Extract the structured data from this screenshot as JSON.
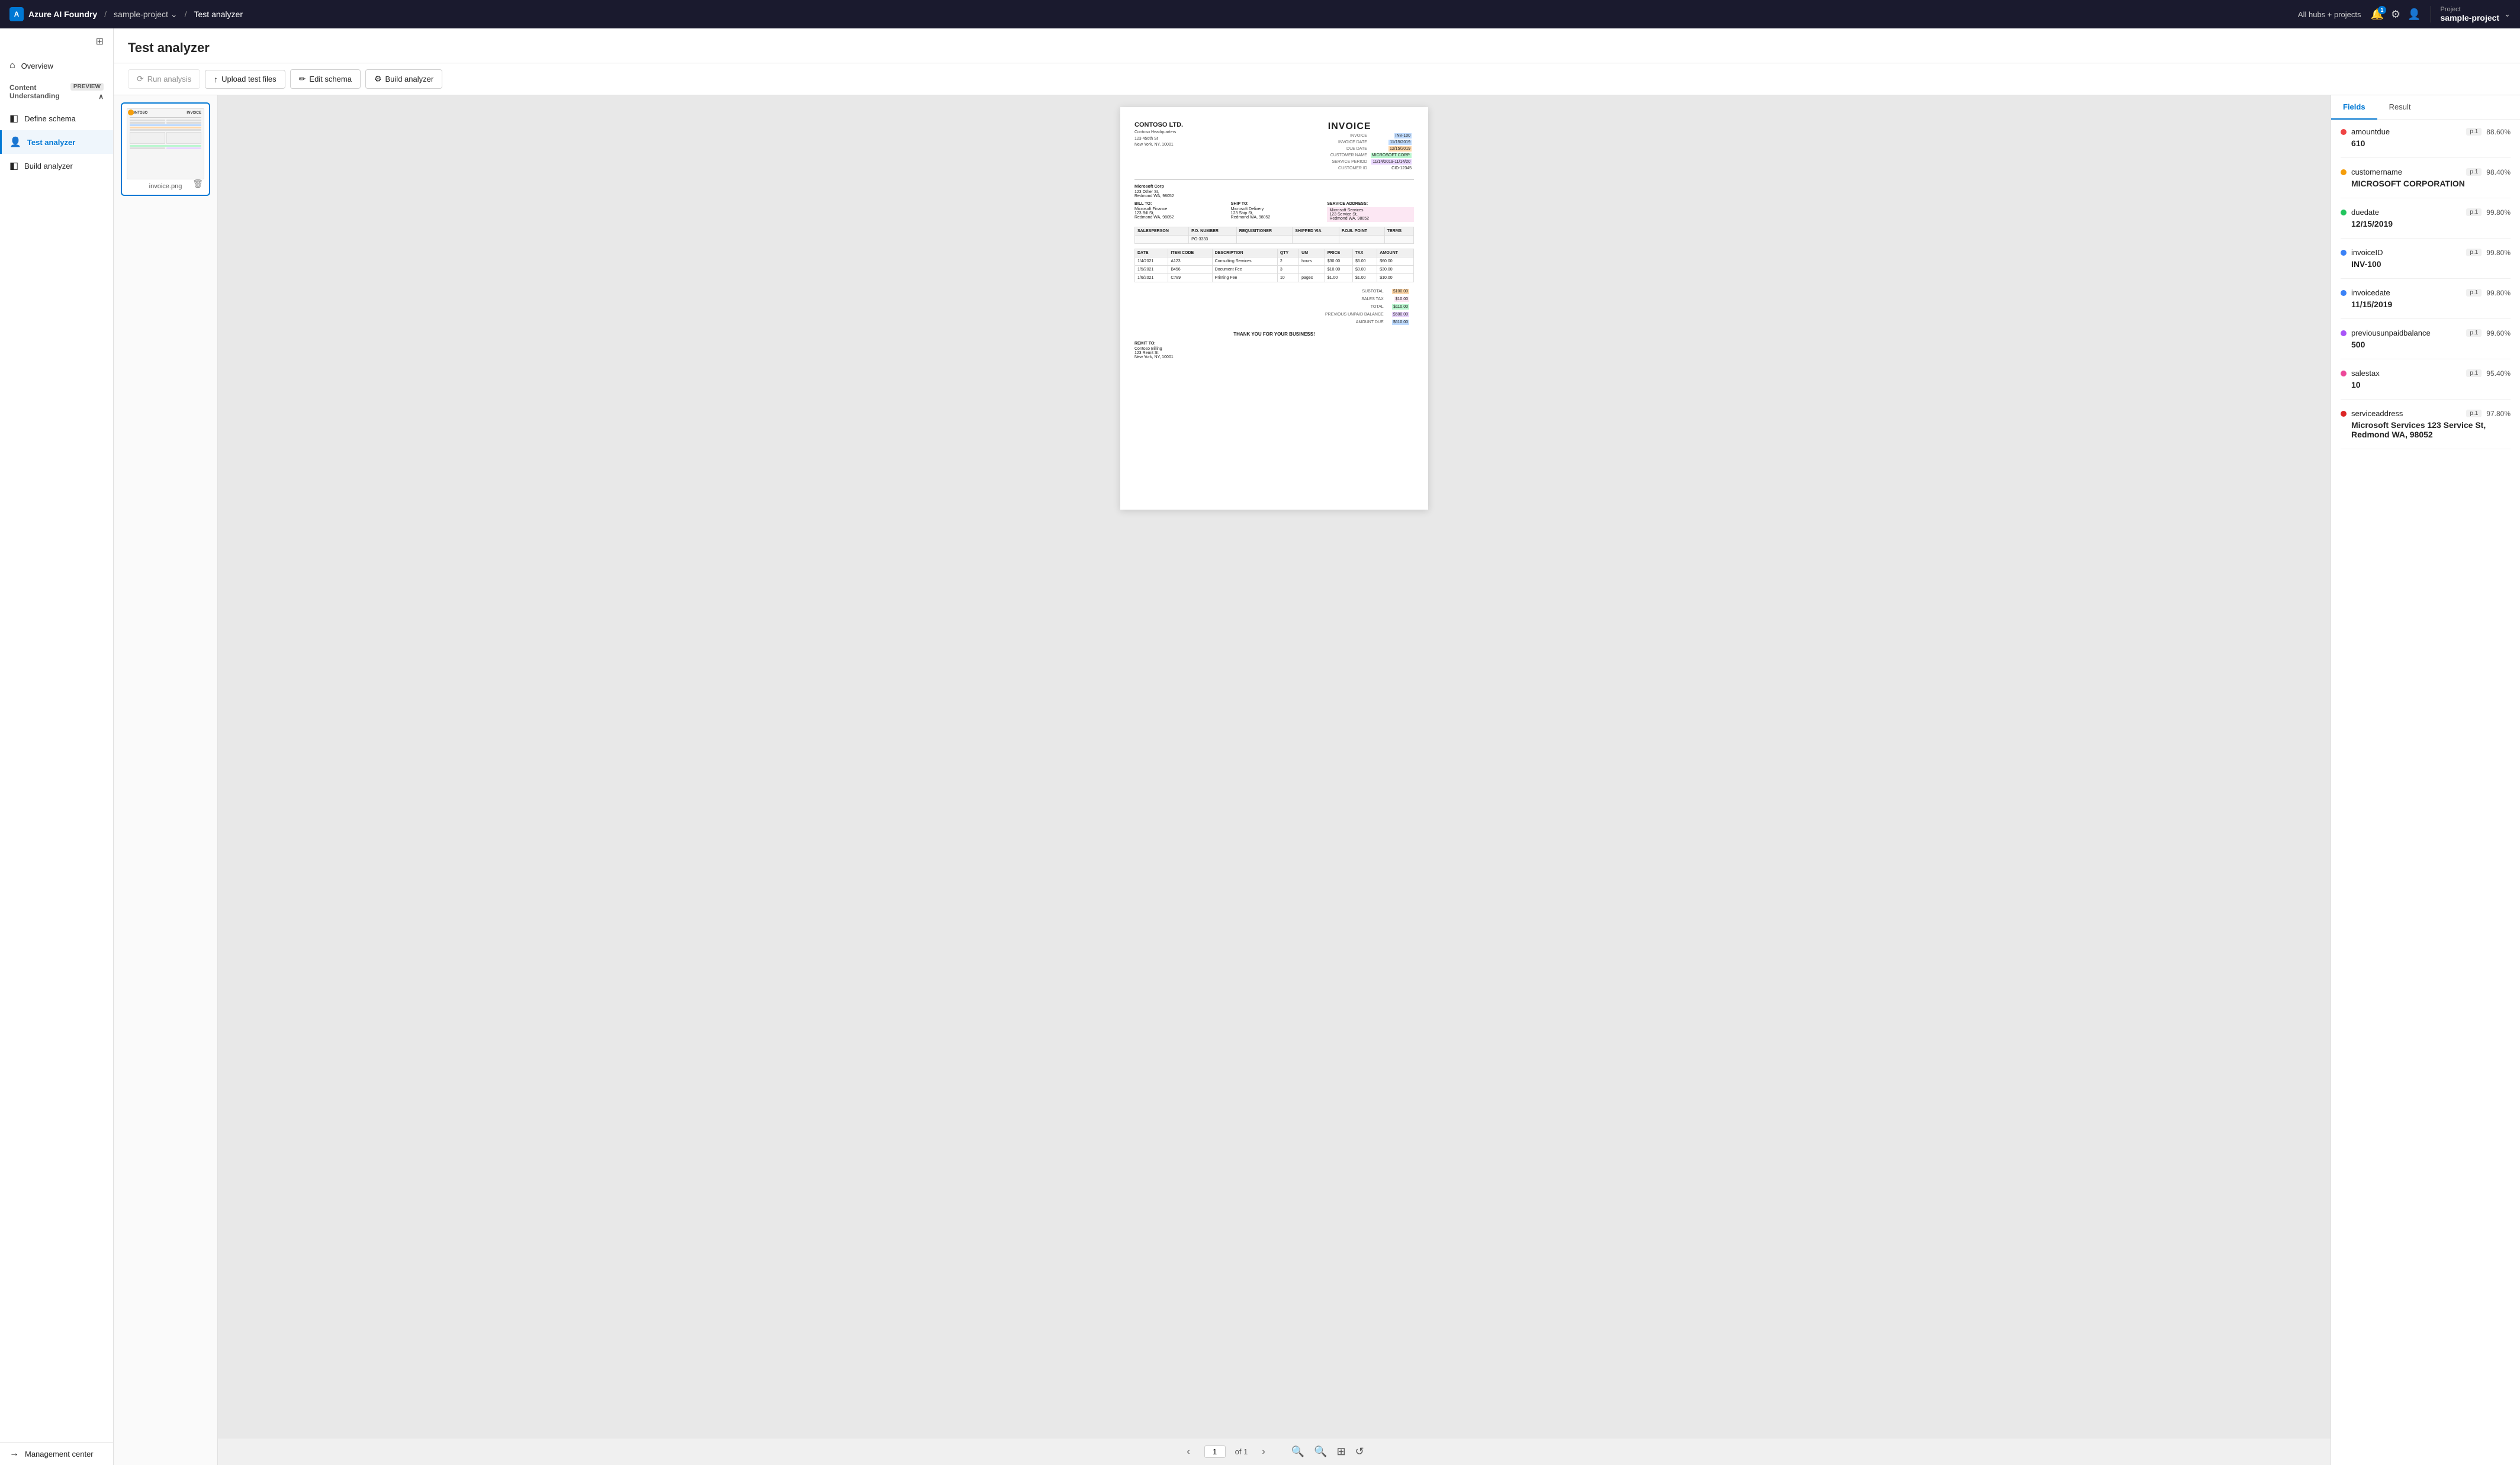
{
  "topnav": {
    "brand": "Azure AI Foundry",
    "breadcrumb": [
      {
        "label": "sample-project",
        "hasChevron": true
      },
      {
        "label": "Test analyzer"
      }
    ],
    "hub_projects": "All hubs + projects",
    "notification_count": "1",
    "project_label": "Project",
    "project_name": "sample-project"
  },
  "sidebar": {
    "toggle_icon": "⊞",
    "overview": "Overview",
    "group_label": "Content Understanding",
    "preview_badge": "PREVIEW",
    "items": [
      {
        "id": "define-schema",
        "label": "Define schema",
        "icon": "◧"
      },
      {
        "id": "test-analyzer",
        "label": "Test analyzer",
        "icon": "👤",
        "active": true
      },
      {
        "id": "build-analyzer",
        "label": "Build analyzer",
        "icon": "◧"
      }
    ],
    "management_center": "Management center"
  },
  "main": {
    "title": "Test analyzer",
    "toolbar": {
      "run_analysis": "Run analysis",
      "upload_test_files": "Upload test files",
      "edit_schema": "Edit schema",
      "build_analyzer": "Build analyzer"
    }
  },
  "file_panel": {
    "file_name": "invoice.png"
  },
  "doc_viewer": {
    "page_num": "1",
    "page_total": "of 1",
    "invoice": {
      "company": "CONTOSO LTD.",
      "title": "INVOICE",
      "address": "Contoso Headquarters\n123 456th St\nNew York, NY, 10001",
      "meta": [
        {
          "label": "INVOICE",
          "value": "INV-100",
          "highlight": "blue"
        },
        {
          "label": "INVOICE DATE",
          "value": "11/15/2019",
          "highlight": "blue"
        },
        {
          "label": "DUE DATE",
          "value": "12/15/2019",
          "highlight": "orange"
        },
        {
          "label": "CUSTOMER NAME",
          "value": "MICROSOFT CORP.",
          "highlight": "green"
        },
        {
          "label": "SERVICE PERIOD",
          "value": "11/14/2019 - 11/14/20",
          "highlight": "purple"
        },
        {
          "label": "CUSTOMER ID",
          "value": "CID-12345"
        }
      ],
      "bill_to": {
        "label": "BILL TO:",
        "name": "Microsoft Finance",
        "addr": "123 Bill St,\nRedmond WA, 98052"
      },
      "ship_to": {
        "label": "SHIP TO:",
        "name": "Microsoft Delivery",
        "addr": "123 Ship St,\nRedmond WA, 98052"
      },
      "service_address": {
        "label": "SERVICE ADDRESS:",
        "value": "123 Service St,\nRedmond WA, 98052"
      },
      "salesperson_row": {
        "salesperson": "SALESPERSON",
        "po_number": "P.O. NUMBER",
        "requisitioner": "REQUISITIONER",
        "shipped_via": "SHIPPED VIA",
        "fob_point": "F.O.B. POINT",
        "terms": "TERMS",
        "po_value": "PO-3333"
      },
      "line_items": [
        {
          "date": "1/4/2021",
          "item": "A123",
          "desc": "Consulting Services",
          "qty": "2",
          "um": "hours",
          "price": "$30.00",
          "tax": "$6.00",
          "amount": "$60.00"
        },
        {
          "date": "1/5/2021",
          "item": "B456",
          "desc": "Document Fee",
          "qty": "3",
          "um": "",
          "price": "$10.00",
          "tax": "$0.00",
          "amount": "$30.00"
        },
        {
          "date": "1/6/2021",
          "item": "C789",
          "desc": "Printing Fee",
          "qty": "10",
          "um": "pages",
          "price": "$1.00",
          "tax": "$1.00",
          "amount": "$10.00"
        }
      ],
      "totals": {
        "subtotal_label": "SUBTOTAL",
        "subtotal_value": "$100.00",
        "sales_tax_label": "SALES TAX",
        "sales_tax_value": "$10.00",
        "total_label": "TOTAL",
        "total_value": "$110.00",
        "prev_balance_label": "PREVIOUS UNPAID BALANCE",
        "prev_balance_value": "$500.00",
        "amount_due_label": "AMOUNT DUE",
        "amount_due_value": "$610.00"
      },
      "thank_you": "THANK YOU FOR YOUR BUSINESS!",
      "remit_to": {
        "label": "REMIT TO:",
        "name": "Contoso Billing",
        "addr": "123 Remit St\nNew York, NY, 10001"
      }
    }
  },
  "right_panel": {
    "tabs": [
      {
        "id": "fields",
        "label": "Fields",
        "active": true
      },
      {
        "id": "result",
        "label": "Result",
        "active": false
      }
    ],
    "fields": [
      {
        "id": "amountdue",
        "name": "amountdue",
        "dot": "dot-red",
        "page": "p.1",
        "confidence": "88.60%",
        "value": "610"
      },
      {
        "id": "customername",
        "name": "customername",
        "dot": "dot-orange",
        "page": "p.1",
        "confidence": "98.40%",
        "value": "MICROSOFT CORPORATION"
      },
      {
        "id": "duedate",
        "name": "duedate",
        "dot": "dot-green",
        "page": "p.1",
        "confidence": "99.80%",
        "value": "12/15/2019"
      },
      {
        "id": "invoiceID",
        "name": "invoiceID",
        "dot": "dot-blue",
        "page": "p.1",
        "confidence": "99.80%",
        "value": "INV-100"
      },
      {
        "id": "invoicedate",
        "name": "invoicedate",
        "dot": "dot-blue",
        "page": "p.1",
        "confidence": "99.80%",
        "value": "11/15/2019"
      },
      {
        "id": "previousunpaidbalance",
        "name": "previousunpaidbalance",
        "dot": "dot-purple",
        "page": "p.1",
        "confidence": "99.60%",
        "value": "500"
      },
      {
        "id": "salestax",
        "name": "salestax",
        "dot": "dot-pink",
        "page": "p.1",
        "confidence": "95.40%",
        "value": "10"
      },
      {
        "id": "serviceaddress",
        "name": "serviceaddress",
        "dot": "dot-darkred",
        "page": "p.1",
        "confidence": "97.80%",
        "value": "Microsoft Services 123 Service St, Redmond WA, 98052"
      }
    ]
  }
}
